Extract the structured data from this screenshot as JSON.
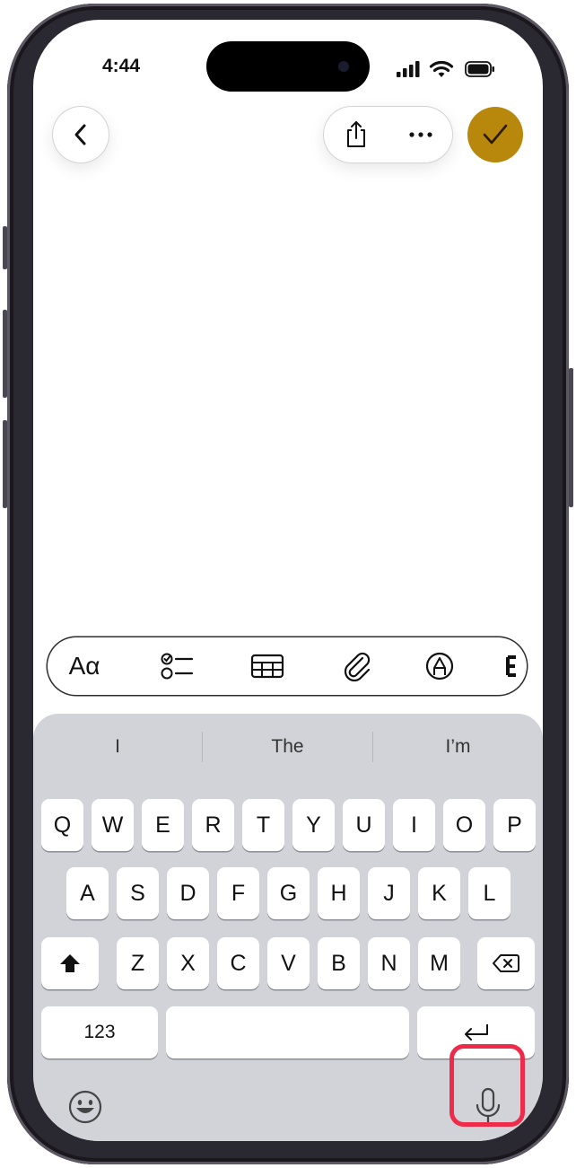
{
  "status_bar": {
    "time": "4:44",
    "icons": [
      "cellular-signal-icon",
      "wifi-icon",
      "battery-icon"
    ]
  },
  "top_bar": {
    "back_icon": "chevron-left-icon",
    "share_icon": "share-icon",
    "more_icon": "ellipsis-icon",
    "done_icon": "checkmark-icon",
    "done_color": "#b8880c"
  },
  "format_bar": {
    "text_style_label": "Aα",
    "items": [
      "checklist-icon",
      "table-icon",
      "paperclip-icon",
      "markup-pen-icon"
    ]
  },
  "keyboard": {
    "suggestions": [
      "I",
      "The",
      "I’m"
    ],
    "row1": [
      "Q",
      "W",
      "E",
      "R",
      "T",
      "Y",
      "U",
      "I",
      "O",
      "P"
    ],
    "row2": [
      "A",
      "S",
      "D",
      "F",
      "G",
      "H",
      "J",
      "K",
      "L"
    ],
    "row3": [
      "Z",
      "X",
      "C",
      "V",
      "B",
      "N",
      "M"
    ],
    "numbers_label": "123",
    "background": "#d1d3d9"
  },
  "highlight_color": "#ee2b4a"
}
